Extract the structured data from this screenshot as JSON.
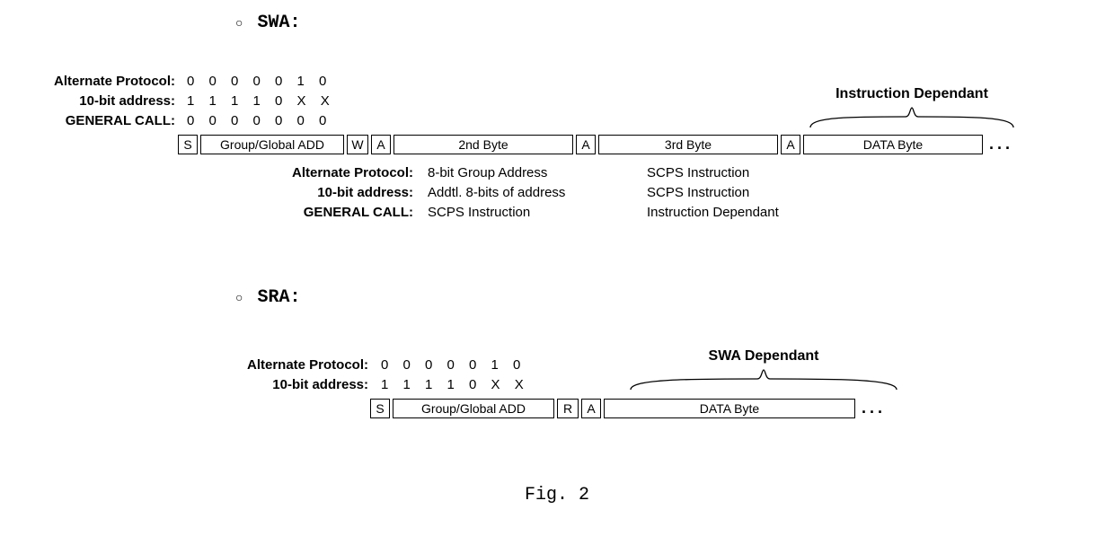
{
  "swa": {
    "heading": "SWA:",
    "upper": {
      "labels": [
        "Alternate Protocol:",
        "10-bit address:",
        "GENERAL CALL:"
      ],
      "bits": [
        "0 0 0 0 0 1 0",
        "1 1 1 1 0 X X",
        "0 0 0 0 0 0 0"
      ]
    },
    "frame": {
      "s": "S",
      "group": "Group/Global ADD",
      "w": "W",
      "a1": "A",
      "byte2": "2nd Byte",
      "a2": "A",
      "byte3": "3rd Byte",
      "a3": "A",
      "data": "DATA Byte",
      "dots": "..."
    },
    "lower": {
      "labels": [
        "Alternate Protocol:",
        "10-bit address:",
        "GENERAL CALL:"
      ],
      "col2": [
        "8-bit Group Address",
        "Addtl. 8-bits of address",
        "SCPS Instruction"
      ],
      "col3": [
        "SCPS Instruction",
        "SCPS Instruction",
        "Instruction Dependant"
      ]
    },
    "brace_label": "Instruction Dependant"
  },
  "sra": {
    "heading": "SRA:",
    "upper": {
      "labels": [
        "Alternate Protocol:",
        "10-bit address:"
      ],
      "bits": [
        "0 0 0 0 0 1 0",
        "1 1 1 1 0 X X"
      ]
    },
    "frame": {
      "s": "S",
      "group": "Group/Global ADD",
      "r": "R",
      "a": "A",
      "data": "DATA Byte",
      "dots": "..."
    },
    "brace_label": "SWA Dependant"
  },
  "figure_caption": "Fig. 2"
}
